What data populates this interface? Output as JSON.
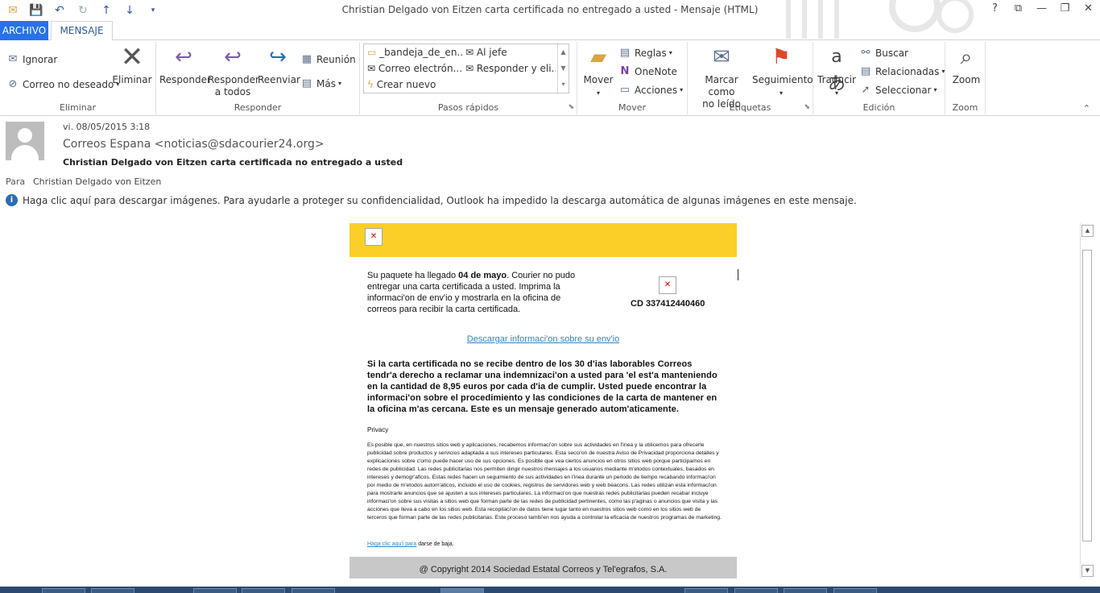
{
  "window": {
    "title": "Christian Delgado von Eitzen carta certificada no entregado a usted - Mensaje (HTML)",
    "controls": {
      "help": "?",
      "restore": "⧉",
      "minimize": "—",
      "maximize": "❐",
      "close": "✕"
    }
  },
  "tabs": {
    "file": "ARCHIVO",
    "message": "MENSAJE"
  },
  "ribbon": {
    "eliminar": {
      "label": "Eliminar",
      "ignore": "Ignorar",
      "junk": "Correo no deseado",
      "delete": "Eliminar"
    },
    "responder": {
      "label": "Responder",
      "reply": "Responder",
      "reply_all_line1": "Responder",
      "reply_all_line2": "a todos",
      "forward": "Reenviar",
      "meeting": "Reunión",
      "more": "Más"
    },
    "quick_steps": {
      "label": "Pasos rápidos",
      "items": [
        "_bandeja_de_en...",
        "Al jefe",
        "Correo electrón...",
        "Responder y eli...",
        "Crear nuevo"
      ]
    },
    "mover": {
      "label": "Mover",
      "move": "Mover",
      "rules": "Reglas",
      "onenote": "OneNote",
      "actions": "Acciones"
    },
    "etiquetas": {
      "label": "Etiquetas",
      "mark_unread_line1": "Marcar como",
      "mark_unread_line2": "no leído",
      "followup": "Seguimiento"
    },
    "edicion": {
      "label": "Edición",
      "translate": "Traducir",
      "find": "Buscar",
      "related": "Relacionadas",
      "select": "Seleccionar"
    },
    "zoom": {
      "label": "Zoom",
      "zoom": "Zoom"
    }
  },
  "header": {
    "date": "vi. 08/05/2015 3:18",
    "sender": "Correos Espana <noticias@sdacourier24.org>",
    "subject": "Christian Delgado von Eitzen carta certificada no entregado a usted",
    "to_label": "Para",
    "to": "Christian Delgado von Eitzen",
    "info": "Haga clic aquí para descargar imágenes. Para ayudarle a proteger su confidencialidad, Outlook ha impedido la descarga automática de algunas imágenes en este mensaje."
  },
  "email": {
    "para1_pre": "Su paquete ha llegado ",
    "para1_bold": "04 de mayo",
    "para1_post": ". Courier no pudo entregar una carta certificada a usted. Imprima la informaci'on de env'io y mostrarla en la oficina de correos para recibir la carta certificada.",
    "tracking": "CD 337412440460",
    "download_link": "Descargar informaci'on sobre su env'io",
    "para2": "Si la carta certificada no se recibe dentro de los 30 d'ias laborables Correos tendr'a derecho a reclamar una indemnizaci'on a usted para 'el est'a manteniendo en la cantidad de 8,95 euros por cada d'ia de cumplir. Usted puede encontrar la informaci'on sobre el procedimiento y las condiciones de la carta de mantener en la oficina m'as cercana. Este es un mensaje generado autom'aticamente.",
    "privacy_title": "Privacy",
    "privacy_body": "Es posible que, en nuestros sitios web y aplicaciones, recabemos informaci'on sobre sus actividades en l'inea y la utilicemos para ofrecerle publicidad sobre productos y servicios adaptada a sus intereses particulares. Esta secci'on de nuestra Aviso de Privacidad proporciona detalles y explicaciones sobre c'omo puede hacer uso de sus opciones. Es posible que vea ciertos anuncios en otros sitios web porque participamos en redes de publicidad. Las redes publicitarias nos permiten dirigir nuestros mensajes a los usuarios mediante m'etodos contextuales, basados en intereses y demogr'aficos. Estas redes hacen un seguimiento de sus actividades en l'inea durante un periodo de tiempo recabando informaci'on por medio de m'etodos autom'aticos, incluido el uso de cookies, registros de servidores web y web beacons. Las redes utilizan esta informaci'on para mostrarle anuncios que se ajusten a sus intereses particulares. La informaci'on que nuestras redes publicitarias pueden recabar incluye informaci'on sobre sus visitas a sitios web que forman parte de las redes de publicidad pertinentes, como las p'aginas o anuncios que visita y las acciones que lleva a cabo en los sitios web. Esta recopilaci'on de datos tiene lugar tanto en nuestros sitios web como en los sitios web de terceros que forman parte de las redes publicitarias. Este proceso tambi'en nos ayuda a controlar la eficacia de nuestros programas de marketing.",
    "unsub_link": "Haga clic aqu'i para",
    "unsub_text": " darse de baja.",
    "footer": "@ Copyright 2014 Sociedad Estatal Correos y Tel'egrafos, S.A."
  },
  "colors": {
    "accent": "#2672ec",
    "yellow": "#fbcf27",
    "footer_gray": "#c8c8c8",
    "link": "#2c86c3"
  }
}
